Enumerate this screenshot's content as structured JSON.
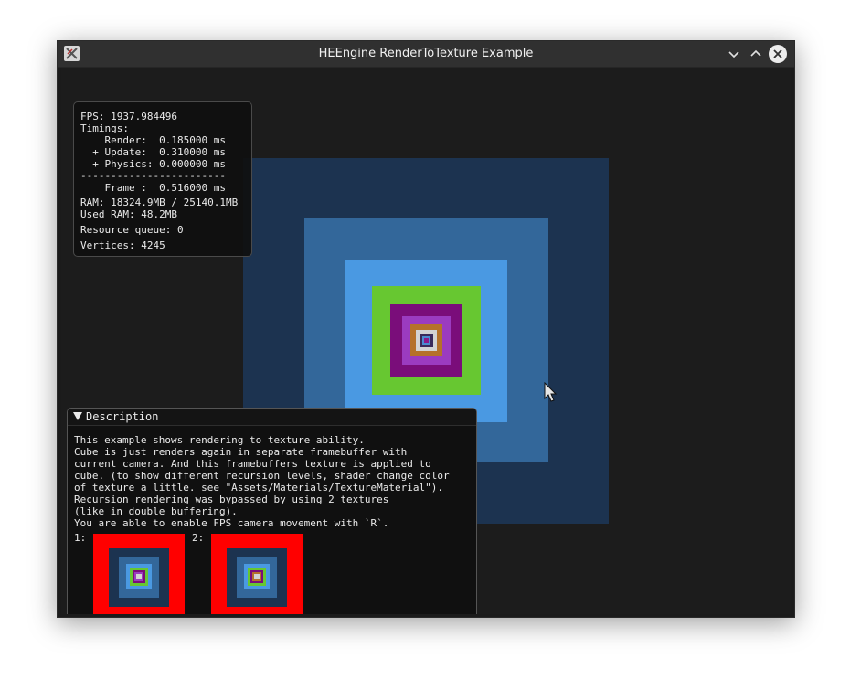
{
  "window": {
    "title": "HEEngine RenderToTexture Example",
    "controls": [
      "minimize",
      "maximize",
      "close"
    ]
  },
  "stats": {
    "fps": "FPS: 1937.984496",
    "timings": "Timings:",
    "render": "    Render:  0.185000 ms",
    "update": "  + Update:  0.310000 ms",
    "physics": "  + Physics: 0.000000 ms",
    "separator": "------------------------",
    "frame": "    Frame :  0.516000 ms",
    "ram": "RAM: 18324.9MB / 25140.1MB",
    "used_ram": "Used RAM: 48.2MB",
    "resource_queue": "Resource queue: 0",
    "vertices": "Vertices: 4245"
  },
  "description": {
    "header": "Description",
    "lines": [
      "This example shows rendering to texture ability.",
      "Cube is just renders again in separate framebuffer with",
      "current camera. And this framebuffers texture is applied to",
      "cube. (to show different recursion levels, shader change color",
      "of texture a little. see \"Assets/Materials/TextureMaterial\").",
      "Recursion rendering was bypassed by using 2 textures",
      "(like in double buffering).",
      "You are able to enable FPS camera movement with `R`."
    ],
    "texture_labels": [
      "1:",
      "2:"
    ]
  },
  "colors": {
    "layer1": "#1c3350",
    "layer2": "#33679a",
    "layer3": "#4a99e2",
    "layer4": "#67c731",
    "layer5": "#7a0d7a",
    "layer6": "#9b3bc0",
    "layer7": "#b5712a",
    "layer8": "#d3d3d3",
    "texture_border": "#ff0000"
  }
}
